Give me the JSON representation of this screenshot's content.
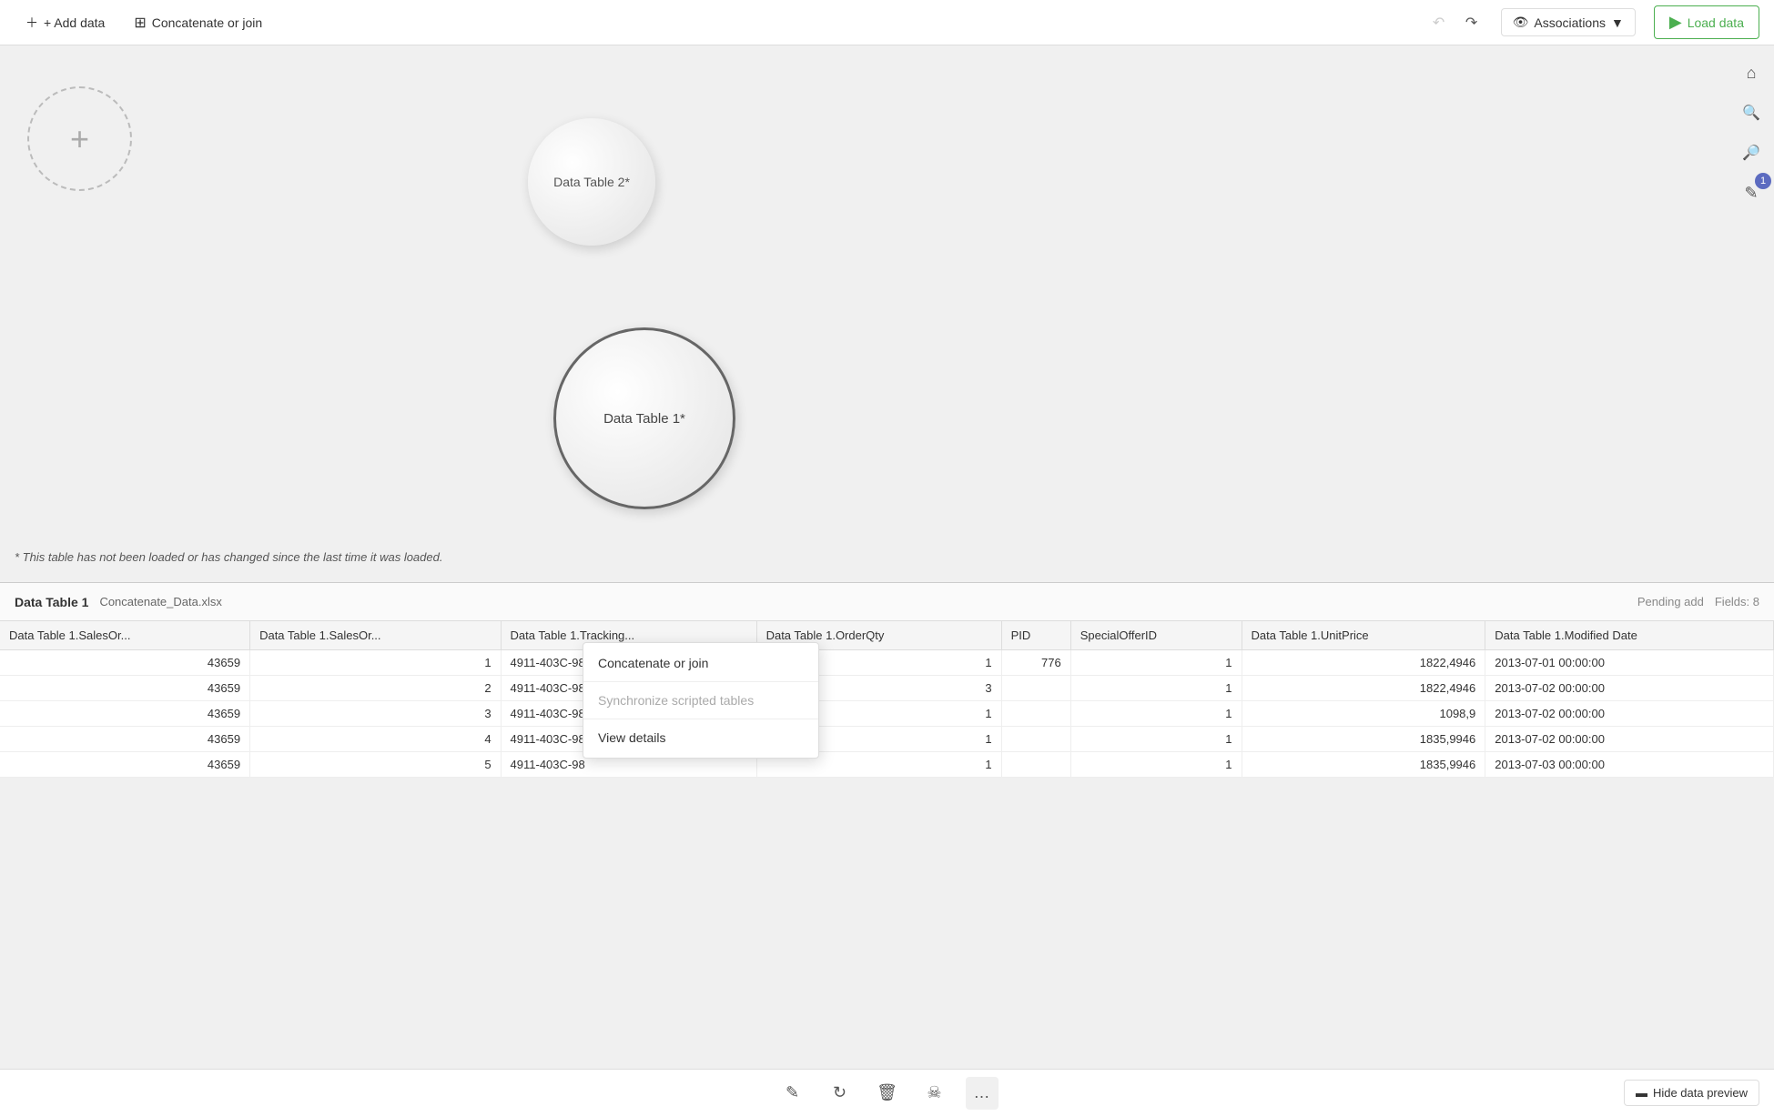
{
  "toolbar": {
    "add_data_label": "+ Add data",
    "concatenate_label": "Concatenate or join",
    "associations_label": "Associations",
    "load_data_label": "Load data"
  },
  "canvas": {
    "add_circle_icon": "+",
    "table2_label": "Data Table 2*",
    "table1_label": "Data Table 1*",
    "note": "* This table has not been loaded or has changed since the last time it was loaded."
  },
  "data_section": {
    "table_name": "Data Table 1",
    "file_name": "Concatenate_Data.xlsx",
    "pending_add": "Pending add",
    "fields_label": "Fields: 8"
  },
  "table_headers": [
    "Data Table 1.SalesOr...",
    "Data Table 1.SalesOr...",
    "Data Table 1.Tracking...",
    "Data Table 1.OrderQty",
    "PID",
    "SpecialOfferID",
    "Data Table 1.UnitPrice",
    "Data Table 1.Modified Date"
  ],
  "table_rows": [
    [
      "43659",
      "1",
      "4911-403C-98",
      "1",
      "776",
      "1",
      "1822,4946",
      "2013-07-01 00:00:00"
    ],
    [
      "43659",
      "2",
      "4911-403C-98",
      "3",
      "",
      "1",
      "1822,4946",
      "2013-07-02 00:00:00"
    ],
    [
      "43659",
      "3",
      "4911-403C-98",
      "1",
      "",
      "1",
      "1098,9",
      "2013-07-02 00:00:00"
    ],
    [
      "43659",
      "4",
      "4911-403C-98",
      "1",
      "",
      "1",
      "1835,9946",
      "2013-07-02 00:00:00"
    ],
    [
      "43659",
      "5",
      "4911-403C-98",
      "1",
      "",
      "1",
      "1835,9946",
      "2013-07-03 00:00:00"
    ]
  ],
  "context_menu": {
    "item1": "Concatenate or join",
    "item2": "Synchronize scripted tables",
    "item3": "View details"
  },
  "bottom_toolbar": {
    "hide_preview_label": "Hide data preview"
  }
}
